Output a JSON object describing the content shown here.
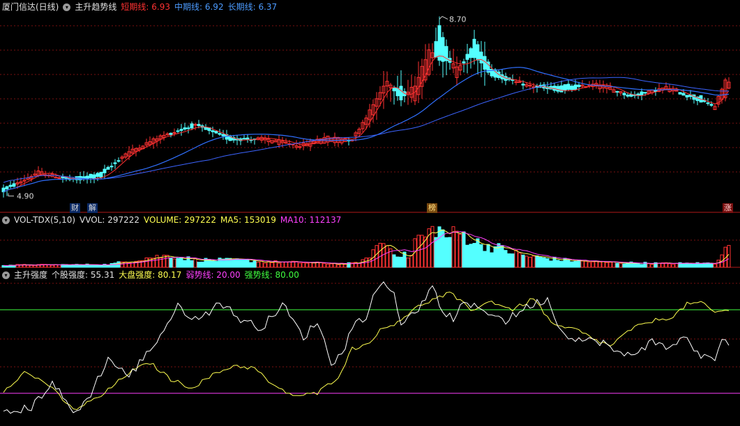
{
  "main_header": {
    "title": "厦门信达(日线)",
    "indicator": "主升趋势线",
    "short_label": "短期线:",
    "short_value": "6.93",
    "mid_label": "中期线:",
    "mid_value": "6.92",
    "long_label": "长期线:",
    "long_value": "6.37"
  },
  "vol_header": {
    "name": "VOL-TDX(5,10)",
    "vvol": "VVOL: 297222",
    "volume": "VOLUME: 297222",
    "ma5": "MA5: 153019",
    "ma10": "MA10: 112137"
  },
  "str_header": {
    "name": "主升强度",
    "stock": "个股强度: 55.31",
    "market": "大盘强度: 80.17",
    "weak": "弱势线: 20.00",
    "strong": "强势线: 80.00"
  },
  "badges": {
    "cai": "财",
    "jie": "解",
    "bang": "榜",
    "zhang": "涨"
  },
  "colors": {
    "up": "#ff3232",
    "down": "#54ffff",
    "short_ma": "#ff3030",
    "mid_ma": "#3070ff",
    "long_ma": "#3c64ff",
    "vol_ma5": "#ffff50",
    "vol_ma10": "#ff40ff",
    "stock_strength": "#ffffff",
    "market_strength": "#ffff50",
    "weak_line": "#ff40ff",
    "strong_line": "#40ff40",
    "grid": "#7a1010"
  },
  "chart_data": [
    {
      "type": "candlestick",
      "title": "厦门信达(日线)",
      "price_range": [
        4.6,
        8.9
      ],
      "annotations": [
        {
          "text": "8.70",
          "kind": "high",
          "value": 8.7
        },
        {
          "text": "4.90",
          "kind": "low",
          "value": 4.9
        }
      ],
      "anchors": {
        "open": [
          [
            0,
            5.06
          ],
          [
            10,
            5.34
          ],
          [
            20,
            5.27
          ],
          [
            28,
            5.41
          ],
          [
            35,
            5.73
          ],
          [
            45,
            6.12
          ],
          [
            55,
            6.43
          ],
          [
            65,
            6.16
          ],
          [
            75,
            6.06
          ],
          [
            85,
            5.94
          ],
          [
            92,
            6.04
          ],
          [
            100,
            6.06
          ],
          [
            105,
            6.5
          ],
          [
            110,
            7.2
          ],
          [
            114,
            7.2
          ],
          [
            118,
            6.9
          ],
          [
            122,
            7.5
          ],
          [
            125,
            8.5
          ],
          [
            130,
            7.4
          ],
          [
            135,
            8.2
          ],
          [
            140,
            7.6
          ],
          [
            150,
            7.2
          ],
          [
            160,
            7.25
          ],
          [
            170,
            7.2
          ],
          [
            180,
            7.05
          ],
          [
            190,
            7.15
          ],
          [
            200,
            7.0
          ],
          [
            204,
            6.75
          ],
          [
            207,
            7.0
          ],
          [
            208,
            7.2
          ]
        ],
        "close": [
          [
            0,
            5.0
          ],
          [
            10,
            5.41
          ],
          [
            20,
            5.23
          ],
          [
            28,
            5.3
          ],
          [
            35,
            5.8
          ],
          [
            45,
            6.16
          ],
          [
            55,
            6.39
          ],
          [
            65,
            6.09
          ],
          [
            75,
            6.12
          ],
          [
            85,
            5.97
          ],
          [
            92,
            6.15
          ],
          [
            100,
            6.1
          ],
          [
            105,
            6.7
          ],
          [
            110,
            7.35
          ],
          [
            114,
            6.95
          ],
          [
            118,
            7.25
          ],
          [
            122,
            8.0
          ],
          [
            125,
            7.8
          ],
          [
            130,
            7.65
          ],
          [
            135,
            7.85
          ],
          [
            140,
            7.45
          ],
          [
            150,
            7.25
          ],
          [
            160,
            7.1
          ],
          [
            170,
            7.3
          ],
          [
            180,
            7.0
          ],
          [
            190,
            7.2
          ],
          [
            200,
            6.9
          ],
          [
            204,
            6.8
          ],
          [
            207,
            7.35
          ],
          [
            208,
            7.3
          ]
        ]
      },
      "ma_short": {
        "name": "短期线",
        "value": 6.93
      },
      "ma_mid": {
        "name": "中期线",
        "value": 6.92
      },
      "ma_long": {
        "name": "长期线",
        "value": 6.37
      }
    },
    {
      "type": "bar",
      "title": "VOL-TDX(5,10)",
      "vol_anchors": [
        [
          0,
          18000
        ],
        [
          30,
          22000
        ],
        [
          42,
          80000
        ],
        [
          48,
          95000
        ],
        [
          55,
          60000
        ],
        [
          62,
          58000
        ],
        [
          70,
          55000
        ],
        [
          75,
          45000
        ],
        [
          85,
          38000
        ],
        [
          92,
          32000
        ],
        [
          96,
          28000
        ],
        [
          100,
          30000
        ],
        [
          104,
          60000
        ],
        [
          106,
          140000
        ],
        [
          109,
          210000
        ],
        [
          111,
          150000
        ],
        [
          114,
          100000
        ],
        [
          117,
          90000
        ],
        [
          118,
          230000
        ],
        [
          121,
          250000
        ],
        [
          124,
          330000
        ],
        [
          127,
          250000
        ],
        [
          131,
          280000
        ],
        [
          136,
          195000
        ],
        [
          142,
          155000
        ],
        [
          150,
          90000
        ],
        [
          160,
          60000
        ],
        [
          170,
          42000
        ],
        [
          180,
          35000
        ],
        [
          190,
          30000
        ],
        [
          200,
          32000
        ],
        [
          204,
          34000
        ],
        [
          206,
          120000
        ],
        [
          208,
          180000
        ]
      ],
      "last_volume": 297222,
      "ma5": 153019,
      "ma10": 112137
    },
    {
      "type": "line",
      "title": "主升强度",
      "ylim": [
        0,
        100
      ],
      "series": [
        {
          "name": "个股强度",
          "anchors": [
            [
              0,
              5
            ],
            [
              8,
              10
            ],
            [
              14,
              28
            ],
            [
              20,
              6
            ],
            [
              24,
              15
            ],
            [
              30,
              45
            ],
            [
              36,
              32
            ],
            [
              44,
              58
            ],
            [
              50,
              82
            ],
            [
              56,
              72
            ],
            [
              62,
              86
            ],
            [
              68,
              73
            ],
            [
              74,
              67
            ],
            [
              80,
              84
            ],
            [
              86,
              60
            ],
            [
              90,
              72
            ],
            [
              94,
              42
            ],
            [
              97,
              48
            ],
            [
              100,
              68
            ],
            [
              104,
              76
            ],
            [
              108,
              100
            ],
            [
              112,
              92
            ],
            [
              114,
              70
            ],
            [
              117,
              78
            ],
            [
              121,
              85
            ],
            [
              123,
              100
            ],
            [
              125,
              80
            ],
            [
              129,
              74
            ],
            [
              132,
              84
            ],
            [
              138,
              80
            ],
            [
              144,
              72
            ],
            [
              150,
              82
            ],
            [
              156,
              88
            ],
            [
              160,
              64
            ],
            [
              166,
              58
            ],
            [
              172,
              57
            ],
            [
              176,
              48
            ],
            [
              180,
              48
            ],
            [
              186,
              57
            ],
            [
              190,
              53
            ],
            [
              196,
              60
            ],
            [
              200,
              46
            ],
            [
              204,
              44
            ],
            [
              206,
              60
            ],
            [
              208,
              55
            ]
          ]
        },
        {
          "name": "大盘强度",
          "anchors": [
            [
              0,
              22
            ],
            [
              6,
              35
            ],
            [
              12,
              28
            ],
            [
              20,
              8
            ],
            [
              28,
              18
            ],
            [
              36,
              35
            ],
            [
              42,
              42
            ],
            [
              48,
              30
            ],
            [
              54,
              24
            ],
            [
              60,
              33
            ],
            [
              66,
              40
            ],
            [
              72,
              38
            ],
            [
              78,
              24
            ],
            [
              84,
              18
            ],
            [
              90,
              20
            ],
            [
              96,
              32
            ],
            [
              100,
              52
            ],
            [
              104,
              55
            ],
            [
              108,
              65
            ],
            [
              112,
              70
            ],
            [
              116,
              77
            ],
            [
              120,
              84
            ],
            [
              128,
              92
            ],
            [
              134,
              80
            ],
            [
              140,
              86
            ],
            [
              146,
              80
            ],
            [
              152,
              88
            ],
            [
              158,
              68
            ],
            [
              164,
              66
            ],
            [
              170,
              58
            ],
            [
              174,
              54
            ],
            [
              180,
              66
            ],
            [
              186,
              72
            ],
            [
              192,
              75
            ],
            [
              196,
              84
            ],
            [
              200,
              85
            ],
            [
              204,
              78
            ],
            [
              208,
              80
            ]
          ]
        }
      ],
      "weak_line": 20,
      "strong_line": 80
    }
  ]
}
